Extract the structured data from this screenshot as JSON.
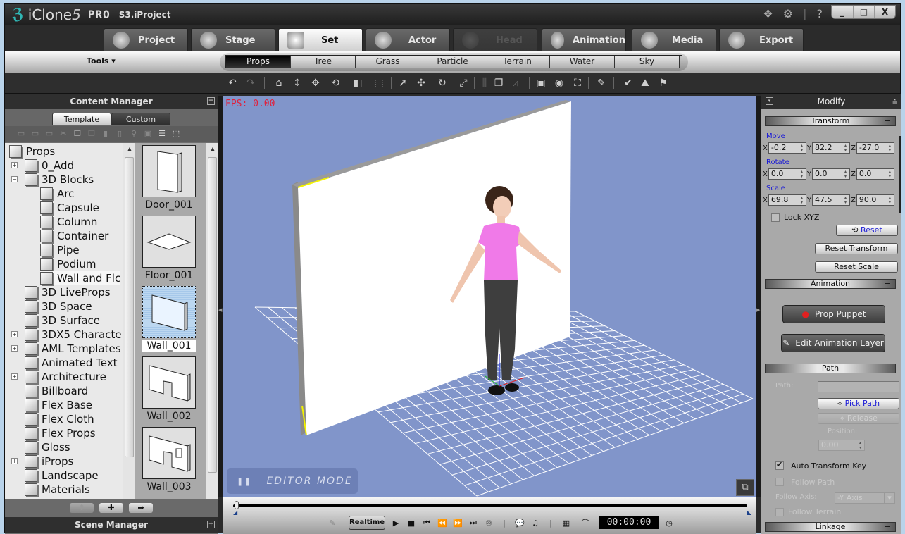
{
  "app": {
    "name": "iClone",
    "version_mark": "5",
    "edition": "PRO",
    "project": "S3.iProject",
    "title_icons": [
      "bonus-pack-icon",
      "settings-icon",
      "help-icon"
    ],
    "help_glyph": "?",
    "window_controls": {
      "minimize": "_",
      "maximize": "□",
      "close": "X"
    }
  },
  "main_tabs": [
    {
      "label": "Project",
      "icon": "project-icon",
      "state": "normal"
    },
    {
      "label": "Stage",
      "icon": "stage-icon",
      "state": "normal"
    },
    {
      "label": "Set",
      "icon": "set-icon",
      "state": "active"
    },
    {
      "label": "Actor",
      "icon": "actor-icon",
      "state": "normal"
    },
    {
      "label": "Head",
      "icon": "head-icon",
      "state": "disabled"
    },
    {
      "label": "Animation",
      "icon": "animation-icon",
      "state": "normal"
    },
    {
      "label": "Media",
      "icon": "media-icon",
      "state": "normal"
    },
    {
      "label": "Export",
      "icon": "export-icon",
      "state": "normal"
    }
  ],
  "subbar": {
    "tools_label": "Tools ▾",
    "tabs": [
      "Props",
      "Tree",
      "Grass",
      "Particle",
      "Terrain",
      "Water",
      "Sky"
    ],
    "active_tab": "Props"
  },
  "toolbar": {
    "glyphs": {
      "undo": "↶",
      "redo": "↷",
      "home": "⌂",
      "move-vertical": "↕",
      "move": "✥",
      "rotate": "⟲",
      "box": "◧",
      "fit": "⬚",
      "select": "➚",
      "transform": "✣",
      "rotate-obj": "↻",
      "scale": "⤢",
      "align": "⫼",
      "duplicate": "❐",
      "path": "⩘",
      "view-single": "▣",
      "camera-view": "◉",
      "fullscreen": "⛶",
      "paint": "✎",
      "pick": "✔",
      "terrain": "⛰",
      "flag": "⚑"
    }
  },
  "content_manager": {
    "title": "Content Manager",
    "collapse": "−",
    "tabs": [
      {
        "label": "Template",
        "active": true
      },
      {
        "label": "Custom",
        "active": false
      }
    ],
    "tree": [
      {
        "label": "Props",
        "level": 0,
        "expander": ""
      },
      {
        "label": "0_Add",
        "level": 1,
        "expander": "+"
      },
      {
        "label": "3D Blocks",
        "level": 1,
        "expander": "−"
      },
      {
        "label": "Arc",
        "level": 2,
        "expander": ""
      },
      {
        "label": "Capsule",
        "level": 2,
        "expander": ""
      },
      {
        "label": "Column",
        "level": 2,
        "expander": ""
      },
      {
        "label": "Container",
        "level": 2,
        "expander": ""
      },
      {
        "label": "Pipe",
        "level": 2,
        "expander": ""
      },
      {
        "label": "Podium",
        "level": 2,
        "expander": ""
      },
      {
        "label": "Wall and Flc",
        "level": 2,
        "expander": "",
        "selected": true
      },
      {
        "label": "3D LiveProps",
        "level": 1,
        "expander": ""
      },
      {
        "label": "3D Space",
        "level": 1,
        "expander": ""
      },
      {
        "label": "3D Surface",
        "level": 1,
        "expander": ""
      },
      {
        "label": "3DX5 Characte",
        "level": 1,
        "expander": "+"
      },
      {
        "label": "AML Templates",
        "level": 1,
        "expander": "+"
      },
      {
        "label": "Animated Text",
        "level": 1,
        "expander": ""
      },
      {
        "label": "Architecture",
        "level": 1,
        "expander": "+"
      },
      {
        "label": "Billboard",
        "level": 1,
        "expander": ""
      },
      {
        "label": "Flex Base",
        "level": 1,
        "expander": ""
      },
      {
        "label": "Flex Cloth",
        "level": 1,
        "expander": ""
      },
      {
        "label": "Flex Props",
        "level": 1,
        "expander": ""
      },
      {
        "label": "Gloss",
        "level": 1,
        "expander": ""
      },
      {
        "label": "iProps",
        "level": 1,
        "expander": "+"
      },
      {
        "label": "Landscape",
        "level": 1,
        "expander": ""
      },
      {
        "label": "Materials",
        "level": 1,
        "expander": ""
      }
    ],
    "thumbnails": [
      {
        "label": "Door_001",
        "shape": "door",
        "selected": false
      },
      {
        "label": "Floor_001",
        "shape": "floor",
        "selected": false
      },
      {
        "label": "Wall_001",
        "shape": "wall",
        "selected": true
      },
      {
        "label": "Wall_002",
        "shape": "wall-door",
        "selected": false
      },
      {
        "label": "Wall_003",
        "shape": "wall-door-window",
        "selected": false
      }
    ],
    "bottom_buttons": [
      {
        "name": "up-button",
        "glyph": "⬆",
        "enabled": false
      },
      {
        "name": "add-button",
        "glyph": "✚",
        "enabled": true
      },
      {
        "name": "apply-button",
        "glyph": "➡",
        "enabled": true
      }
    ]
  },
  "scene_manager": {
    "title": "Scene Manager",
    "expand": "+"
  },
  "viewport": {
    "fps_label": "FPS: 0.00",
    "mode_label": "EDITOR MODE",
    "pause_glyph": "❚❚",
    "restore_glyph": "⧉",
    "background": "#8195ca"
  },
  "timeline": {
    "realtime_label": "Realtime",
    "timecode": "00:00:00",
    "controls": [
      "▶",
      "■",
      "⏮",
      "⏪",
      "⏩",
      "⏭"
    ],
    "position": 0
  },
  "modify": {
    "title": "Modify",
    "transform": {
      "title": "Transform",
      "move_label": "Move",
      "rotate_label": "Rotate",
      "scale_label": "Scale",
      "move": {
        "x": "-0.2",
        "y": "82.2",
        "z": "-27.0"
      },
      "rotate": {
        "x": "0.0",
        "y": "0.0",
        "z": "0.0"
      },
      "scale": {
        "x": "69.8",
        "y": "47.5",
        "z": "90.0"
      },
      "lock_xyz_label": "Lock XYZ",
      "lock_xyz": false,
      "reset_label": "Reset",
      "reset_transform_label": "Reset Transform",
      "reset_scale_label": "Reset Scale"
    },
    "animation": {
      "title": "Animation",
      "prop_puppet_label": "Prop Puppet",
      "edit_layer_label": "Edit Animation Layer"
    },
    "path": {
      "title": "Path",
      "path_label": "Path:",
      "path_value": "",
      "pick_path_label": "Pick Path",
      "release_label": "Release",
      "position_label": "Position:",
      "position_value": "0.00",
      "auto_transform_key_label": "Auto Transform Key",
      "auto_transform_key": true,
      "follow_path_label": "Follow Path",
      "follow_path": false,
      "follow_axis_label": "Follow Axis:",
      "follow_axis_value": "-Y Axis",
      "follow_terrain_label": "Follow Terrain",
      "follow_terrain": false
    },
    "linkage": {
      "title": "Linkage"
    }
  }
}
